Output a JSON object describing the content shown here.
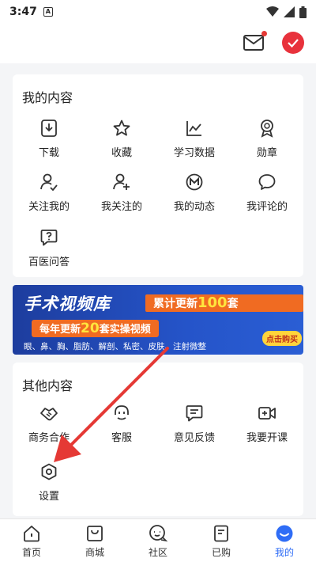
{
  "status": {
    "time": "3:47",
    "app_badge": "A"
  },
  "my_content": {
    "title": "我的内容",
    "items": [
      {
        "label": "下载",
        "icon": "download-icon"
      },
      {
        "label": "收藏",
        "icon": "star-icon"
      },
      {
        "label": "学习数据",
        "icon": "chart-icon"
      },
      {
        "label": "勋章",
        "icon": "medal-icon"
      },
      {
        "label": "关注我的",
        "icon": "user-check-icon"
      },
      {
        "label": "我关注的",
        "icon": "user-add-icon"
      },
      {
        "label": "我的动态",
        "icon": "activity-icon"
      },
      {
        "label": "我评论的",
        "icon": "comment-icon"
      },
      {
        "label": "百医问答",
        "icon": "question-icon"
      }
    ]
  },
  "banner": {
    "title": "手术视频库",
    "line1_prefix": "累计更新",
    "line1_num": "100",
    "line1_suffix": "套",
    "line2_prefix": "每年更新",
    "line2_num": "20",
    "line2_suffix": "套实操视频",
    "line3": "眼、鼻、胸、脂肪、解剖、私密、皮肤、注射微整",
    "buy": "点击购买"
  },
  "other_content": {
    "title": "其他内容",
    "items": [
      {
        "label": "商务合作",
        "icon": "handshake-icon"
      },
      {
        "label": "客服",
        "icon": "headset-icon"
      },
      {
        "label": "意见反馈",
        "icon": "feedback-icon"
      },
      {
        "label": "我要开课",
        "icon": "video-add-icon"
      },
      {
        "label": "设置",
        "icon": "settings-icon"
      }
    ]
  },
  "tabs": [
    {
      "label": "首页",
      "icon": "home-icon"
    },
    {
      "label": "商城",
      "icon": "shop-icon"
    },
    {
      "label": "社区",
      "icon": "community-icon"
    },
    {
      "label": "已购",
      "icon": "purchased-icon"
    },
    {
      "label": "我的",
      "icon": "me-icon",
      "active": true
    }
  ],
  "colors": {
    "accent": "#2f6df6",
    "arrow": "#e53935",
    "avatar": "#e8323c"
  }
}
